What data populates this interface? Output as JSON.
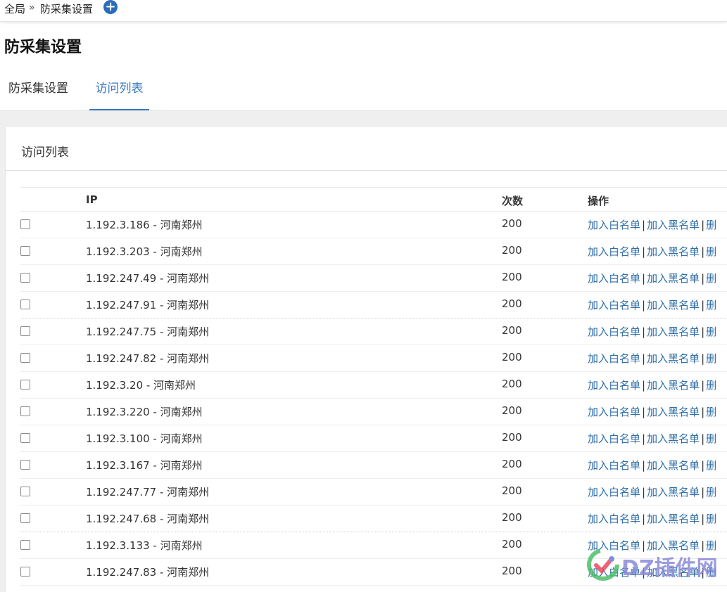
{
  "breadcrumb": {
    "root": "全局",
    "separator": "»",
    "current": "防采集设置",
    "add_icon": "plus-circle-icon"
  },
  "page": {
    "title": "防采集设置"
  },
  "tabs": [
    {
      "label": "防采集设置",
      "active": false
    },
    {
      "label": "访问列表",
      "active": true
    }
  ],
  "panel": {
    "title": "访问列表"
  },
  "table": {
    "headers": {
      "ip": "IP",
      "count": "次数",
      "ops": "操作"
    },
    "ops_labels": {
      "whitelist": "加入白名单",
      "blacklist": "加入黑名单",
      "delete": "删",
      "separator": "|"
    },
    "rows": [
      {
        "ip": "1.192.3.186 - 河南郑州",
        "count": "200"
      },
      {
        "ip": "1.192.3.203 - 河南郑州",
        "count": "200"
      },
      {
        "ip": "1.192.247.49 - 河南郑州",
        "count": "200"
      },
      {
        "ip": "1.192.247.91 - 河南郑州",
        "count": "200"
      },
      {
        "ip": "1.192.247.75 - 河南郑州",
        "count": "200"
      },
      {
        "ip": "1.192.247.82 - 河南郑州",
        "count": "200"
      },
      {
        "ip": "1.192.3.20 - 河南郑州",
        "count": "200"
      },
      {
        "ip": "1.192.3.220 - 河南郑州",
        "count": "200"
      },
      {
        "ip": "1.192.3.100 - 河南郑州",
        "count": "200"
      },
      {
        "ip": "1.192.3.167 - 河南郑州",
        "count": "200"
      },
      {
        "ip": "1.192.247.77 - 河南郑州",
        "count": "200"
      },
      {
        "ip": "1.192.247.68 - 河南郑州",
        "count": "200"
      },
      {
        "ip": "1.192.3.133 - 河南郑州",
        "count": "200"
      },
      {
        "ip": "1.192.247.83 - 河南郑州",
        "count": "200"
      }
    ]
  },
  "watermark": {
    "text": "DZ插件网",
    "logo": "check-logo-icon"
  },
  "colors": {
    "accent": "#3a7bbf",
    "link": "#2f6ea8",
    "background": "#efefef"
  }
}
